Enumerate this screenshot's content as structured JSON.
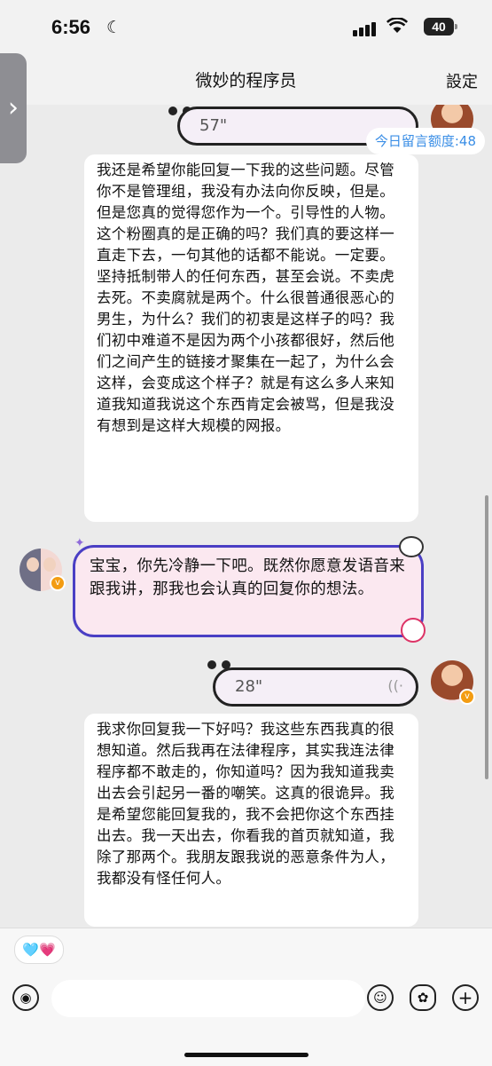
{
  "status_bar": {
    "time": "6:56",
    "battery": "40"
  },
  "nav": {
    "title": "微妙的程序员",
    "settings_label": "設定"
  },
  "quota": {
    "label": "今日留言额度:48"
  },
  "messages": [
    {
      "type": "voice",
      "side": "right",
      "duration": "57\""
    },
    {
      "type": "text",
      "side": "left",
      "text": "我还是希望你能回复一下我的这些问题。尽管你不是管理组，我没有办法向你反映，但是。但是您真的觉得您作为一个。引导性的人物。这个粉圈真的是正确的吗？我们真的要这样一直走下去，一句其他的话都不能说。一定要。坚持抵制带人的任何东西，甚至会说。不卖虎去死。不卖腐就是两个。什么很普通很恶心的男生，为什么？我们的初衷是这样子的吗？我们初中难道不是因为两个小孩都很好，然后他们之间产生的链接才聚集在一起了，为什么会这样，会变成这个样子？就是有这么多人来知道我知道我说这个东西肯定会被骂，但是我没有想到是这样大规模的网报。"
    },
    {
      "type": "text",
      "side": "left-avatar",
      "text": "宝宝，你先冷静一下吧。既然你愿意发语音来跟我讲，那我也会认真的回复你的想法。"
    },
    {
      "type": "voice",
      "side": "right",
      "duration": "28\""
    },
    {
      "type": "text",
      "side": "left",
      "text": "我求你回复我一下好吗？我这些东西我真的很想知道。然后我再在法律程序，其实我连法律程序都不敢走的，你知道吗？因为我知道我卖出去会引起另一番的嘲笑。这真的很诡异。我是希望您能回复我的，我不会把你这个东西挂出去。我一天出去，你看我的首页就知道，我除了那两个。我朋友跟我说的恶意条件为人，我都没有怪任何人。"
    }
  ],
  "bottom": {
    "emoji_chip": "🩵💗",
    "input_placeholder": ""
  }
}
